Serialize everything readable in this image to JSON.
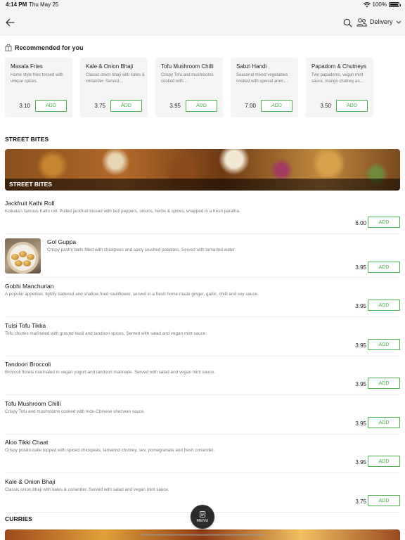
{
  "status_bar": {
    "time": "4:14 PM",
    "date": "Thu May 25",
    "battery": "100%"
  },
  "nav": {
    "delivery_label": "Delivery"
  },
  "recommended": {
    "title": "Recommended for you",
    "items": [
      {
        "name": "Masala Fries",
        "desc": "Home style fries tossed with unique spices.",
        "price": "3.10",
        "add": "ADD"
      },
      {
        "name": "Kale & Onion Bhaji",
        "desc": "Classic onion bhaji with kales & coriander. Served…",
        "price": "3.75",
        "add": "ADD"
      },
      {
        "name": "Tofu Mushroom Chilli",
        "desc": "Crispy Tofu and mushrooms cooked with…",
        "price": "3.95",
        "add": "ADD"
      },
      {
        "name": "Sabzi Handi",
        "desc": "Seasonal mixed vegetables cooked with special arom…",
        "price": "7.00",
        "add": "ADD"
      },
      {
        "name": "Papadom & Chutneys",
        "desc": "Two papadoms, vegan mint sauce, mango chutney an…",
        "price": "3.50",
        "add": "ADD"
      }
    ]
  },
  "street_bites": {
    "title": "STREET BITES",
    "banner_label": "STREET BITES",
    "items": [
      {
        "name": "Jackfruit Kathi Roll",
        "desc": "Kolkata's famous Kathi roll. Pulled jackfruit tossed with bell peppers, onions, herbs & spices, wrapped in a fresh paratha.",
        "price": "6.00",
        "add": "ADD"
      },
      {
        "name": "Gol Guppa",
        "desc": "Crispy pastry balls filled with chickpeas and spicy crushed potatoes. Served with tamarind water.",
        "price": "3.95",
        "add": "ADD"
      },
      {
        "name": "Gobhi Manchurian",
        "desc": "A popular appetiser, lightly battered and shallow fried cauliflower, served in a fresh home made ginger, garlic, chilli and soy sauce.",
        "price": "3.95",
        "add": "ADD"
      },
      {
        "name": "Tulsi Tofu Tikka",
        "desc": "Tofu chunks marinated with ground basil and tandoori spices. Served with salad and vegan mint sauce.",
        "price": "3.95",
        "add": "ADD"
      },
      {
        "name": "Tandoori Broccoli",
        "desc": "Broccoli florets marinated in vegan yogurt and tandoori marinade. Served with salad and vegan mint sauce.",
        "price": "3.95",
        "add": "ADD"
      },
      {
        "name": "Tofu Mushroom Chilli",
        "desc": "Crispy Tofu and mushrooms cooked with Indo-Chinese shezwan sauce.",
        "price": "3.95",
        "add": "ADD"
      },
      {
        "name": "Aloo Tikki Chaat",
        "desc": "Crispy potato cake topped with spiced chickpeas, tamarind chutney, sev, pomegranate and fresh coriander.",
        "price": "3.95",
        "add": "ADD"
      },
      {
        "name": "Kale & Onion Bhaji",
        "desc": "Classic onion bhaji with kales & coriander. Served with salad and vegan mint sauce.",
        "price": "3.75",
        "add": "ADD"
      }
    ]
  },
  "curries": {
    "title": "CURRIES"
  },
  "fab": {
    "label": "MENU"
  },
  "colors": {
    "accent": "#4caf50",
    "nav_bg": "#f5f5f5"
  }
}
